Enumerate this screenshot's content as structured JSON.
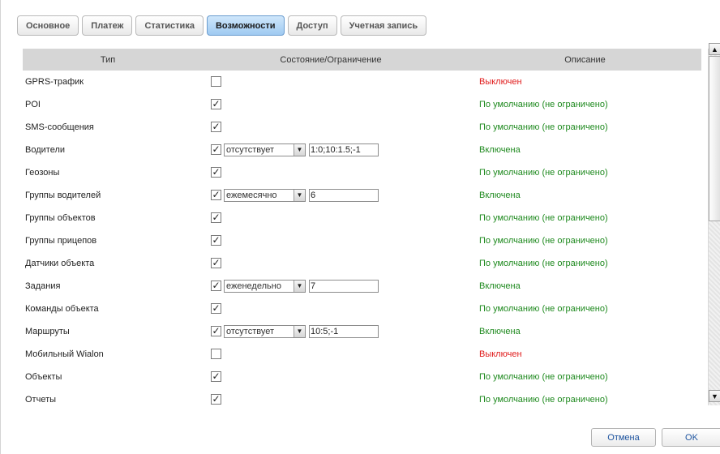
{
  "tabs": [
    {
      "label": "Основное",
      "active": false
    },
    {
      "label": "Платеж",
      "active": false
    },
    {
      "label": "Статистика",
      "active": false
    },
    {
      "label": "Возможности",
      "active": true
    },
    {
      "label": "Доступ",
      "active": false
    },
    {
      "label": "Учетная запись",
      "active": false
    }
  ],
  "table": {
    "headers": {
      "type": "Тип",
      "state": "Состояние/Ограничение",
      "description": "Описание"
    },
    "rows": [
      {
        "type": "GPRS-трафик",
        "checked": false,
        "description": "Выключен",
        "status": "off"
      },
      {
        "type": "POI",
        "checked": true,
        "description": "По умолчанию (не ограничено)",
        "status": "on"
      },
      {
        "type": "SMS-сообщения",
        "checked": true,
        "description": "По умолчанию (не ограничено)",
        "status": "on"
      },
      {
        "type": "Водители",
        "checked": true,
        "period": "отсутствует",
        "limit": "1:0;10:1.5;-1",
        "description": "Включена",
        "status": "on"
      },
      {
        "type": "Геозоны",
        "checked": true,
        "description": "По умолчанию (не ограничено)",
        "status": "on"
      },
      {
        "type": "Группы водителей",
        "checked": true,
        "period": "ежемесячно",
        "limit": "6",
        "description": "Включена",
        "status": "on"
      },
      {
        "type": "Группы объектов",
        "checked": true,
        "description": "По умолчанию (не ограничено)",
        "status": "on"
      },
      {
        "type": "Группы прицепов",
        "checked": true,
        "description": "По умолчанию (не ограничено)",
        "status": "on"
      },
      {
        "type": "Датчики объекта",
        "checked": true,
        "description": "По умолчанию (не ограничено)",
        "status": "on"
      },
      {
        "type": "Задания",
        "checked": true,
        "period": "еженедельно",
        "limit": "7",
        "description": "Включена",
        "status": "on"
      },
      {
        "type": "Команды объекта",
        "checked": true,
        "description": "По умолчанию (не ограничено)",
        "status": "on"
      },
      {
        "type": "Маршруты",
        "checked": true,
        "period": "отсутствует",
        "limit": "10:5;-1",
        "description": "Включена",
        "status": "on"
      },
      {
        "type": "Мобильный Wialon",
        "checked": false,
        "description": "Выключен",
        "status": "off"
      },
      {
        "type": "Объекты",
        "checked": true,
        "description": "По умолчанию (не ограничено)",
        "status": "on"
      },
      {
        "type": "Отчеты",
        "checked": true,
        "description": "По умолчанию (не ограничено)",
        "status": "on"
      }
    ]
  },
  "buttons": {
    "cancel": "Отмена",
    "ok": "OK"
  },
  "icons": {
    "check": "✓",
    "dropdown": "▼",
    "scroll_up": "▲",
    "scroll_down": "▼"
  },
  "colors": {
    "status_off": "#e01b1b",
    "status_on": "#1f8a1f",
    "active_tab": "#9fcaf1"
  }
}
